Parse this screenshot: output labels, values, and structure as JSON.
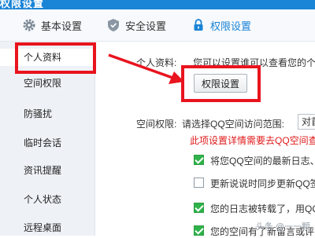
{
  "window": {
    "title": "权限设置"
  },
  "topnav": {
    "tabs": [
      {
        "label": "基本设置",
        "icon": "gear-icon"
      },
      {
        "label": "安全设置",
        "icon": "shield-icon"
      },
      {
        "label": "权限设置",
        "icon": "lock-icon",
        "active": true
      }
    ]
  },
  "sidebar": {
    "items": [
      {
        "label": "个人资料",
        "active": true
      },
      {
        "label": "空间权限"
      },
      {
        "label": "防骚扰"
      },
      {
        "label": "临时会话"
      },
      {
        "label": "资讯提醒"
      },
      {
        "label": "个人状态"
      },
      {
        "label": "远程桌面"
      }
    ]
  },
  "main": {
    "profile": {
      "label": "个人资料:",
      "description": "您可以设置谁可以查看您的个",
      "button": "权限设置"
    },
    "space": {
      "label": "空间权限:",
      "prompt": "请选择QQ空间访问范围:",
      "select_value": "对首",
      "warning": "此项设置详情需要去QQ空间查"
    },
    "options": [
      {
        "label": "将您QQ空间的最新日志、",
        "checked": true
      },
      {
        "label": "更新说说时同步更新QQ签",
        "checked": false
      },
      {
        "label": "您的日志被转载了，用QQ",
        "checked": true
      },
      {
        "label": "您的空间有了新留言或评",
        "checked": true
      }
    ]
  },
  "watermark": "头条 @一一颗",
  "colors": {
    "accent": "#1a84d6",
    "highlight": "#e8141e",
    "check": "#2fb34a",
    "warning": "#e01b1b"
  }
}
